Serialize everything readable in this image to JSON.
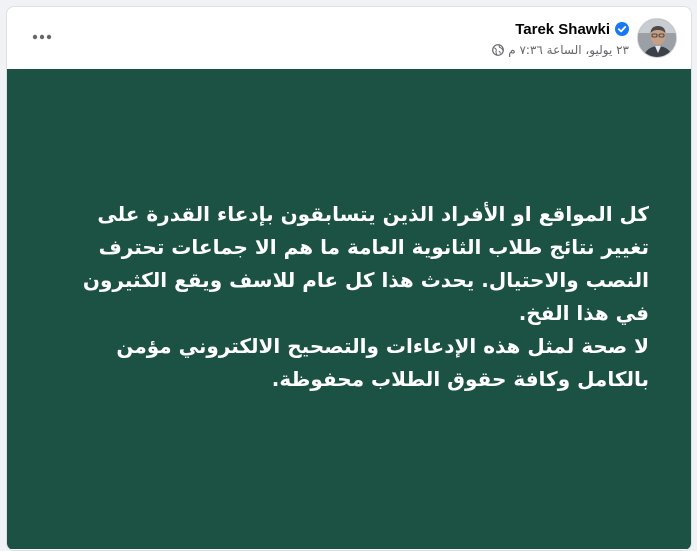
{
  "post": {
    "author": "Tarek Shawki",
    "timestamp": "٢٣ يوليو، الساعة ٧:٣٦ م",
    "body_text": "كل المواقع او الأفراد الذين يتسابقون بإدعاء القدرة على تغيير نتائج طلاب الثانوية العامة ما هم الا جماعات تحترف النصب والاحتيال. يحدث هذا كل عام للاسف ويقع الكثيرون في هذا الفخ.\nلا صحة لمثل هذه الإدعاءات والتصحيح الالكتروني مؤمن بالكامل وكافة حقوق الطلاب محفوظة.",
    "background_color": "#1b5243",
    "text_color": "#ffffff"
  },
  "icons": {
    "verified": "verified-badge-icon",
    "audience": "globe-icon",
    "more": "more-options-icon"
  }
}
